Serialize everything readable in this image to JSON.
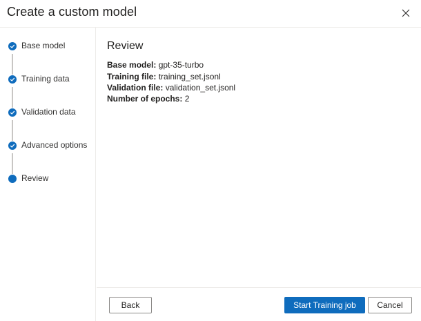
{
  "dialog": {
    "title": "Create a custom model",
    "close_icon": "close-icon"
  },
  "steps": [
    {
      "label": "Base model",
      "status": "completed",
      "icon": "checkmark-icon"
    },
    {
      "label": "Training data",
      "status": "completed",
      "icon": "checkmark-icon"
    },
    {
      "label": "Validation data",
      "status": "completed",
      "icon": "checkmark-icon"
    },
    {
      "label": "Advanced options",
      "status": "completed",
      "icon": "checkmark-icon"
    },
    {
      "label": "Review",
      "status": "current",
      "icon": "current-step-dot"
    }
  ],
  "review": {
    "heading": "Review",
    "fields": [
      {
        "key": "Base model:",
        "value": "gpt-35-turbo"
      },
      {
        "key": "Training file:",
        "value": "training_set.jsonl"
      },
      {
        "key": "Validation file:",
        "value": "validation_set.jsonl"
      },
      {
        "key": "Number of epochs:",
        "value": "2"
      }
    ]
  },
  "footer": {
    "back_label": "Back",
    "start_label": "Start Training job",
    "cancel_label": "Cancel"
  },
  "colors": {
    "accent": "#0f6cbd",
    "connector": "#c8c6c4",
    "divider": "#edebe9"
  }
}
